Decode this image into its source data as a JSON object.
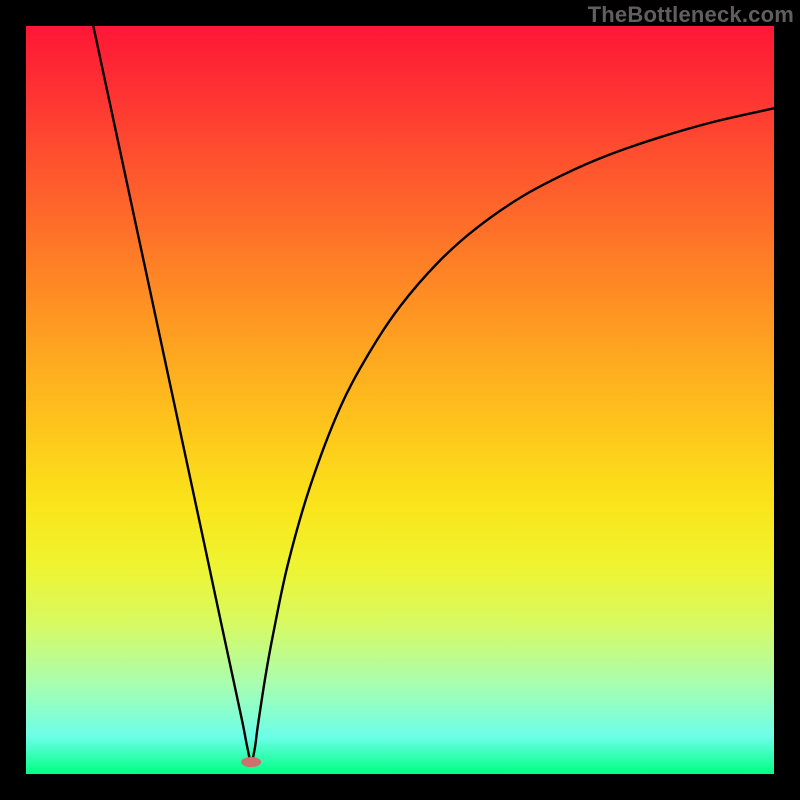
{
  "watermark": "TheBottleneck.com",
  "colors": {
    "frame": "#000000",
    "gradient_css": "background: linear-gradient(to bottom, #fe1736 0%, #fe2f33 8%, #fe4b2f 16%, #fe652b 24%, #fe8026 32%, #fe9a22 40%, #feb41e 48%, #fdcd1b 56%, #fae41a 64%, #eff430 72%, #d7fa63 80%, #a8feb0 88%, #6cfee8 95%, #00ff83 100%);",
    "curve": "#000000",
    "min_marker": "#cf6f6e"
  },
  "chart_data": {
    "type": "line",
    "title": "",
    "xlabel": "",
    "ylabel": "",
    "xlim": [
      0,
      100
    ],
    "ylim": [
      0,
      100
    ],
    "min_point": {
      "x": 30.1,
      "y": 1.6
    },
    "series": [
      {
        "name": "bottleneck-curve",
        "x": [
          9.0,
          12.0,
          15.0,
          18.0,
          21.0,
          24.0,
          26.0,
          28.0,
          29.0,
          29.6,
          30.1,
          30.6,
          31.0,
          32.0,
          33.0,
          35.0,
          38.0,
          42.0,
          46.0,
          50.0,
          55.0,
          60.0,
          66.0,
          72.0,
          78.0,
          85.0,
          92.0,
          100.0
        ],
        "y": [
          100.0,
          86.0,
          72.0,
          58.0,
          44.0,
          30.0,
          20.6,
          11.3,
          6.6,
          3.5,
          1.6,
          3.5,
          6.5,
          13.0,
          18.5,
          28.0,
          38.5,
          49.0,
          56.5,
          62.5,
          68.3,
          72.8,
          77.0,
          80.2,
          82.8,
          85.2,
          87.2,
          89.0
        ]
      }
    ]
  }
}
